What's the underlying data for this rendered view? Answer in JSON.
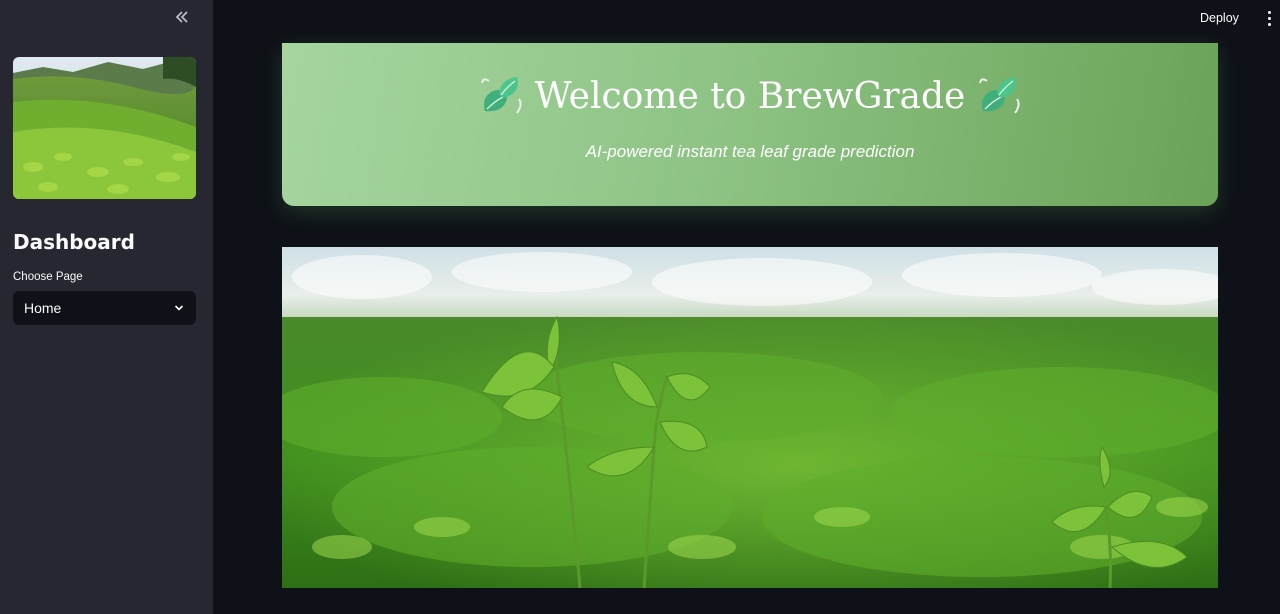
{
  "sidebar": {
    "collapse_icon": "chevron-double-left-icon",
    "title": "Dashboard",
    "select_label": "Choose Page",
    "selected_page": "Home"
  },
  "header": {
    "deploy_label": "Deploy",
    "menu_icon": "vertical-dots-icon"
  },
  "hero": {
    "title": "Welcome to BrewGrade",
    "subtitle": "AI-powered instant tea leaf grade prediction",
    "icon": "leaf-icon"
  },
  "colors": {
    "background": "#0e1117",
    "sidebar": "#262730",
    "hero_gradient_start": "#a6d5a0",
    "hero_gradient_end": "#6aa357",
    "text": "#fafafa"
  }
}
